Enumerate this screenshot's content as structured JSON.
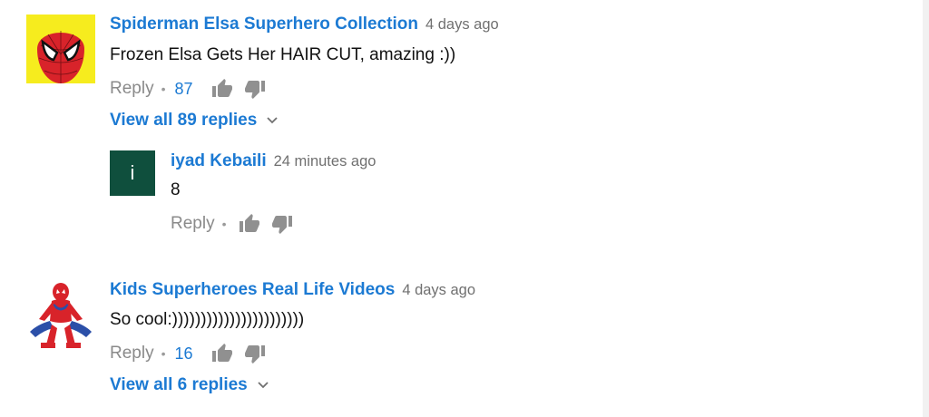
{
  "colors": {
    "link": "#1c7ad3",
    "muted": "#8a8a8a",
    "avatar_letter_bg": "#0f4f3d"
  },
  "comments": [
    {
      "author": "Spiderman Elsa Superhero Collection",
      "time": "4 days ago",
      "text": "Frozen Elsa Gets Her HAIR CUT, amazing :))",
      "reply_label": "Reply",
      "dot": "•",
      "likes": "87",
      "view_replies": "View all 89 replies",
      "avatar_icon": "spiderman-mask-avatar"
    },
    {
      "author": "iyad Kebaili",
      "time": "24 minutes ago",
      "text": "8",
      "reply_label": "Reply",
      "dot": "•",
      "avatar_letter": "i"
    },
    {
      "author": "Kids Superheroes Real Life Videos",
      "time": "4 days ago",
      "text": "So cool:)))))))))))))))))))))))",
      "reply_label": "Reply",
      "dot": "•",
      "likes": "16",
      "view_replies": "View all 6 replies",
      "avatar_icon": "spiderman-crouching-avatar"
    }
  ]
}
